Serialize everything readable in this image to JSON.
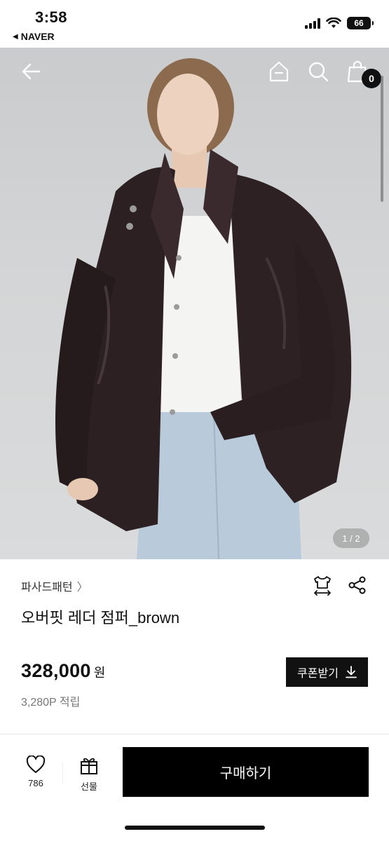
{
  "status_bar": {
    "time": "3:58",
    "back_app": "NAVER",
    "battery": "66"
  },
  "gallery": {
    "page_indicator": "1 / 2",
    "current_page": 1,
    "total_pages": 2,
    "cart_count": "0"
  },
  "product": {
    "brand": "파사드패턴",
    "title": "오버핏 레더 점퍼_brown",
    "price": "328,000",
    "currency": "원",
    "points": "3,280P 적립",
    "coupon_label": "쿠폰받기"
  },
  "bottom_bar": {
    "like_count": "786",
    "gift_label": "선물",
    "buy_label": "구매하기"
  },
  "icons": {
    "back": "back-arrow-icon",
    "home": "home-icon",
    "search": "search-icon",
    "cart": "shopping-bag-icon",
    "size": "size-guide-icon",
    "share": "share-icon",
    "download": "download-icon",
    "heart": "heart-icon",
    "gift": "gift-icon"
  },
  "colors": {
    "accent": "#000000",
    "muted_text": "#777777"
  }
}
